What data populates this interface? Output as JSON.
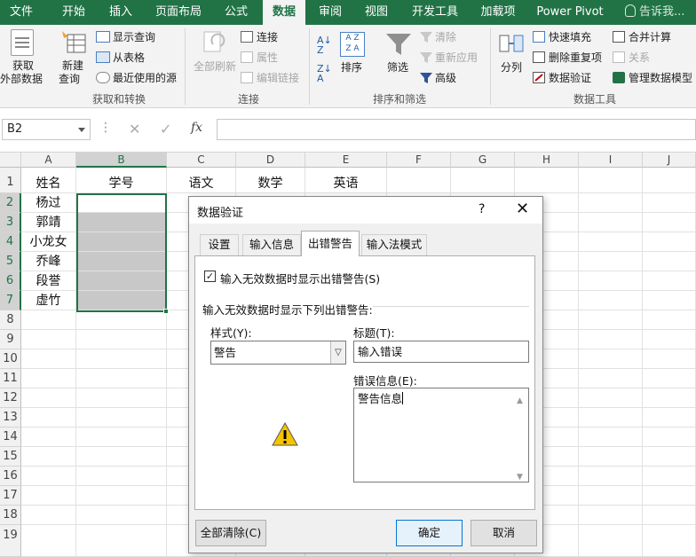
{
  "ribbon_tabs": [
    "文件",
    "开始",
    "插入",
    "页面布局",
    "公式",
    "数据",
    "审阅",
    "视图",
    "开发工具",
    "加载项",
    "Power Pivot"
  ],
  "tell_me": "告诉我...",
  "get_transform": {
    "get_external": "获取\n外部数据",
    "get_ext_line1": "获取",
    "get_ext_line2": "外部数据",
    "new_query_line1": "新建",
    "new_query_line2": "查询",
    "show_queries": "显示查询",
    "from_table": "从表格",
    "recent_sources": "最近使用的源",
    "group_label": "获取和转换"
  },
  "connections": {
    "refresh_all_line1": "全部刷新",
    "connections": "连接",
    "properties": "属性",
    "edit_links": "编辑链接",
    "group_label": "连接"
  },
  "sort_filter": {
    "sort": "排序",
    "filter": "筛选",
    "clear": "清除",
    "reapply": "重新应用",
    "advanced": "高级",
    "group_label": "排序和筛选"
  },
  "data_tools": {
    "text_to_columns": "分列",
    "flash_fill": "快速填充",
    "remove_duplicates": "删除重复项",
    "data_validation": "数据验证",
    "consolidate": "合并计算",
    "relationships": "关系",
    "manage_model": "管理数据模型",
    "group_label": "数据工具"
  },
  "name_box": "B2",
  "formula_buttons": {
    "cancel": "✕",
    "enter": "✓",
    "fx": "fx"
  },
  "columns": [
    "A",
    "B",
    "C",
    "D",
    "E",
    "F",
    "G",
    "H",
    "I",
    "J"
  ],
  "rows": [
    "1",
    "2",
    "3",
    "4",
    "5",
    "6",
    "7",
    "8",
    "9",
    "10",
    "11",
    "12",
    "13",
    "14",
    "15",
    "16",
    "17",
    "18",
    "19"
  ],
  "cells": {
    "A1": "姓名",
    "B1": "学号",
    "C1": "语文",
    "D1": "数学",
    "E1": "英语",
    "A2": "杨过",
    "A3": "郭靖",
    "A4": "小龙女",
    "A5": "乔峰",
    "A6": "段誉",
    "A7": "虚竹"
  },
  "dialog": {
    "title": "数据验证",
    "help": "?",
    "close": "✕",
    "tabs": [
      "设置",
      "输入信息",
      "出错警告",
      "输入法模式"
    ],
    "show_error_checkbox": "输入无效数据时显示出错警告(S)",
    "checked": true,
    "section_label": "输入无效数据时显示下列出错警告:",
    "style_label": "样式(Y):",
    "style_value": "警告",
    "title_label": "标题(T):",
    "title_value": "输入错误",
    "message_label": "错误信息(E):",
    "message_value": "警告信息",
    "clear_all": "全部清除(C)",
    "ok": "确定",
    "cancel": "取消"
  },
  "colors": {
    "accent": "#217346",
    "selection_fill": "#c8c8c8"
  }
}
